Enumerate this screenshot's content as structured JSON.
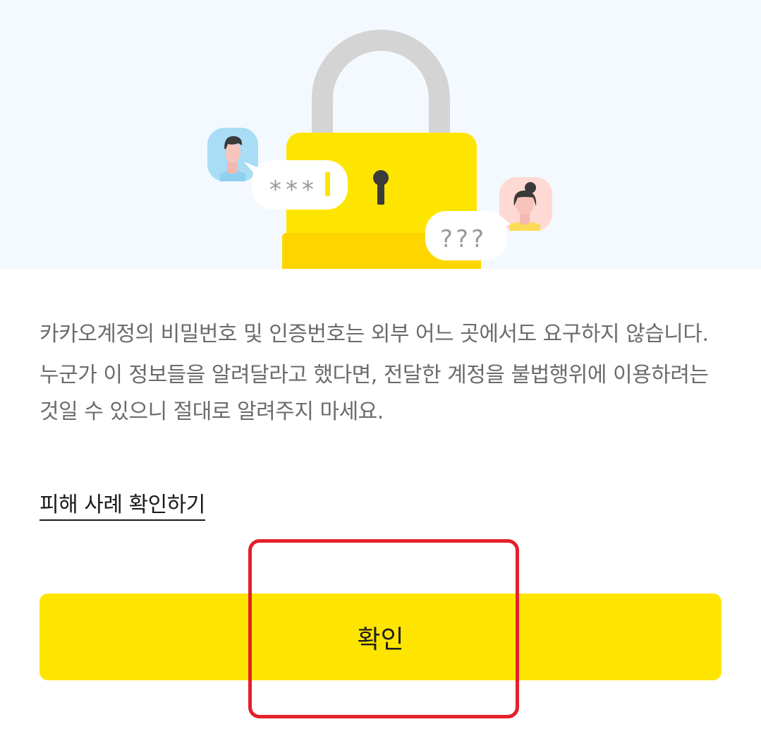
{
  "hero": {
    "masked_password": "***",
    "question_marks": "???"
  },
  "notice": {
    "paragraph1": "카카오계정의 비밀번호 및 인증번호는 외부 어느 곳에서도 요구하지 않습니다.",
    "paragraph2": "누군가 이 정보들을 알려달라고 했다면, 전달한 계정을 불법행위에 이용하려는 것일 수 있으니 절대로 알려주지 마세요."
  },
  "link_label": "피해 사례 확인하기",
  "confirm_label": "확인",
  "colors": {
    "brand_yellow": "#fee500",
    "hero_background": "#f3f9fe",
    "highlight_red": "#e3202b"
  }
}
